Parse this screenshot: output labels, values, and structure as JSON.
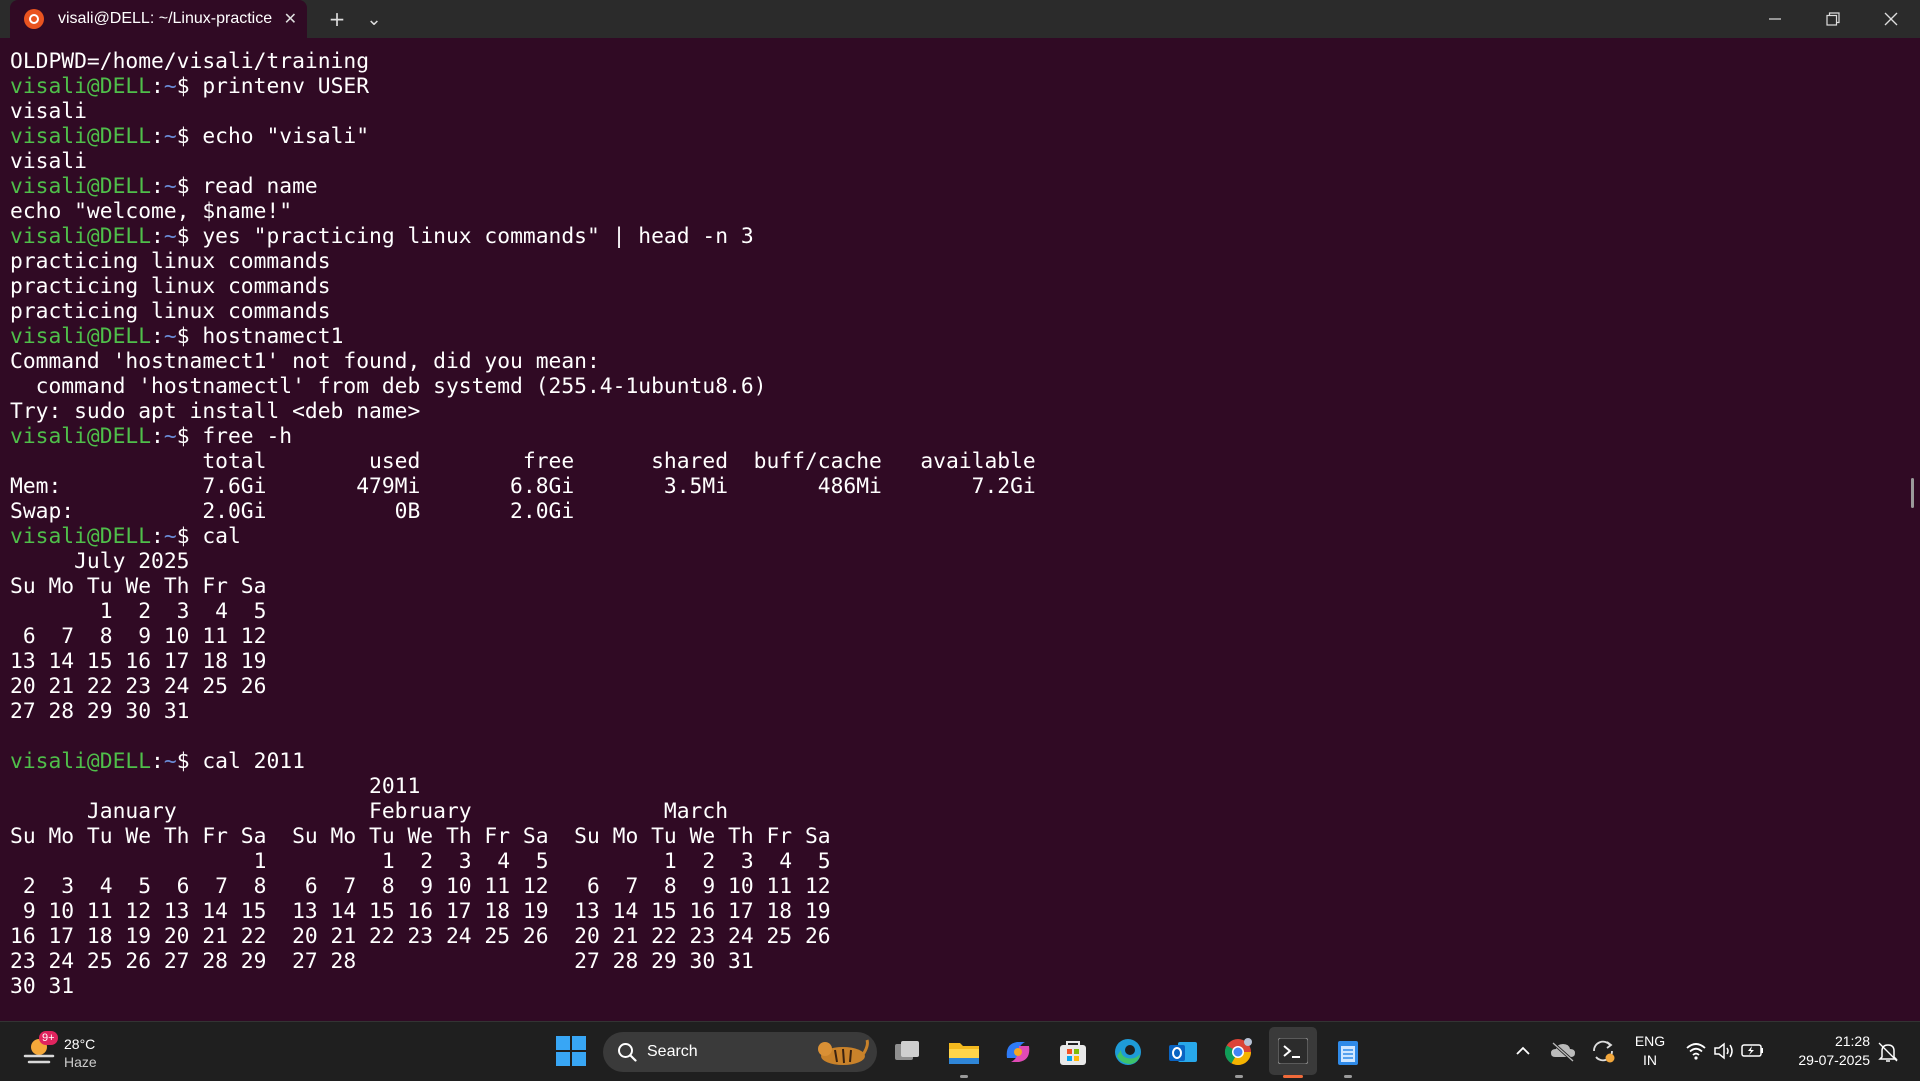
{
  "window": {
    "tab_title": "visali@DELL: ~/Linux-practice",
    "tab_close": "✕",
    "new_tab": "+",
    "tab_dropdown": "⌄"
  },
  "terminal": {
    "lines": [
      {
        "text": "OLDPWD=/home/visali/training"
      },
      {
        "user": "visali@DELL",
        "sep": ":",
        "path": "~",
        "cmd": "$ printenv USER"
      },
      {
        "text": "visali"
      },
      {
        "user": "visali@DELL",
        "sep": ":",
        "path": "~",
        "cmd": "$ echo \"visali\""
      },
      {
        "text": "visali"
      },
      {
        "user": "visali@DELL",
        "sep": ":",
        "path": "~",
        "cmd": "$ read name"
      },
      {
        "text": "echo \"welcome, $name!\""
      },
      {
        "user": "visali@DELL",
        "sep": ":",
        "path": "~",
        "cmd": "$ yes \"practicing linux commands\" | head -n 3"
      },
      {
        "text": "practicing linux commands"
      },
      {
        "text": "practicing linux commands"
      },
      {
        "text": "practicing linux commands"
      },
      {
        "user": "visali@DELL",
        "sep": ":",
        "path": "~",
        "cmd": "$ hostnamect1"
      },
      {
        "text": "Command 'hostnamect1' not found, did you mean:"
      },
      {
        "text": "  command 'hostnamectl' from deb systemd (255.4-1ubuntu8.6)"
      },
      {
        "text": "Try: sudo apt install <deb name>"
      },
      {
        "user": "visali@DELL",
        "sep": ":",
        "path": "~",
        "cmd": "$ free -h"
      },
      {
        "text": "               total        used        free      shared  buff/cache   available"
      },
      {
        "text": "Mem:           7.6Gi       479Mi       6.8Gi       3.5Mi       486Mi       7.2Gi"
      },
      {
        "text": "Swap:          2.0Gi          0B       2.0Gi"
      },
      {
        "user": "visali@DELL",
        "sep": ":",
        "path": "~",
        "cmd": "$ cal"
      },
      {
        "text": "     July 2025"
      },
      {
        "text": "Su Mo Tu We Th Fr Sa"
      },
      {
        "text": "       1  2  3  4  5"
      },
      {
        "text": " 6  7  8  9 10 11 12"
      },
      {
        "text": "13 14 15 16 17 18 19"
      },
      {
        "text": "20 21 22 23 24 25 26"
      },
      {
        "text": "27 28 29 30 31"
      },
      {
        "text": ""
      },
      {
        "user": "visali@DELL",
        "sep": ":",
        "path": "~",
        "cmd": "$ cal 2011"
      },
      {
        "text": "                            2011"
      },
      {
        "text": "      January               February               March"
      },
      {
        "text": "Su Mo Tu We Th Fr Sa  Su Mo Tu We Th Fr Sa  Su Mo Tu We Th Fr Sa"
      },
      {
        "text": "                   1         1  2  3  4  5         1  2  3  4  5"
      },
      {
        "text": " 2  3  4  5  6  7  8   6  7  8  9 10 11 12   6  7  8  9 10 11 12"
      },
      {
        "text": " 9 10 11 12 13 14 15  13 14 15 16 17 18 19  13 14 15 16 17 18 19"
      },
      {
        "text": "16 17 18 19 20 21 22  20 21 22 23 24 25 26  20 21 22 23 24 25 26"
      },
      {
        "text": "23 24 25 26 27 28 29  27 28                 27 28 29 30 31"
      },
      {
        "text": "30 31"
      }
    ]
  },
  "taskbar": {
    "weather_temp": "28°C",
    "weather_cond": "Haze",
    "weather_badge": "9+",
    "search_label": "Search",
    "lang_top": "ENG",
    "lang_bottom": "IN",
    "time": "21:28",
    "date": "29-07-2025",
    "tray_chevron": "^"
  },
  "colors": {
    "terminal_bg": "#300a24",
    "prompt_user": "#4fbf4a",
    "prompt_path": "#6a8bd6",
    "ubuntu_orange": "#e95420"
  }
}
